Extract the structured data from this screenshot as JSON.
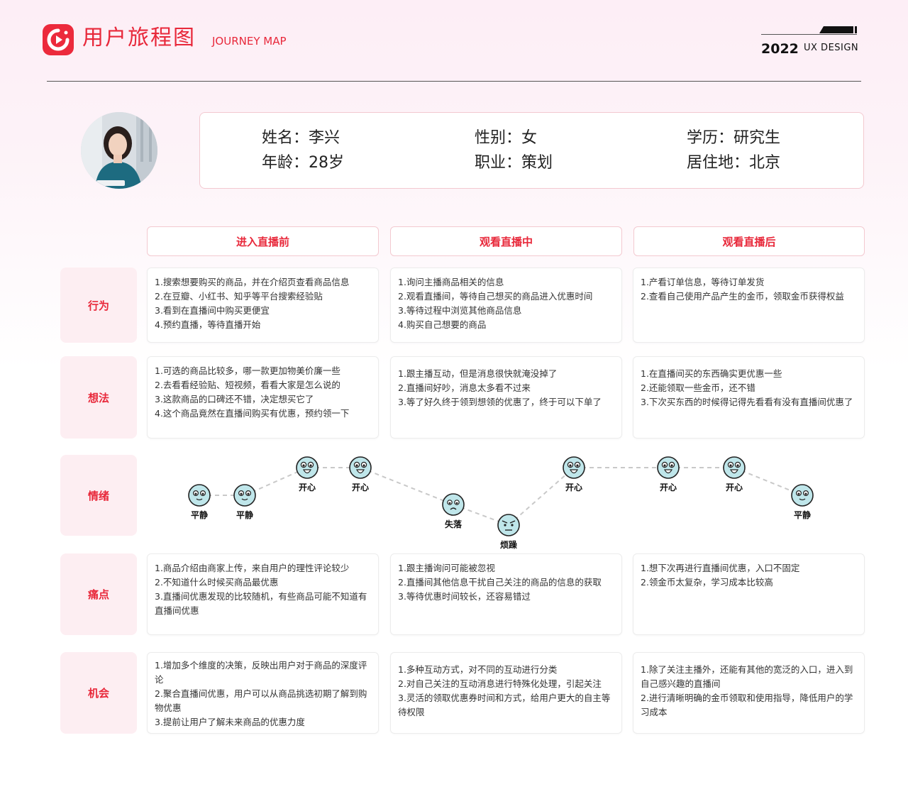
{
  "header": {
    "title": "用户旅程图",
    "subtitle": "JOURNEY MAP",
    "year": "2022",
    "ux": "UX DESIGN"
  },
  "profile": {
    "name": "姓名：李兴",
    "gender": "性别：女",
    "education": "学历：研究生",
    "age": "年龄：28岁",
    "job": "职业：策划",
    "residence": "居住地：北京"
  },
  "phases": [
    "进入直播前",
    "观看直播中",
    "观看直播后"
  ],
  "rows": {
    "behavior": {
      "label": "行为",
      "cards": [
        [
          "1.搜索想要购买的商品，并在介绍页查看商品信息",
          "2.在豆瓣、小红书、知乎等平台搜索经验贴",
          "3.看到在直播间中购买更便宜",
          "4.预约直播，等待直播开始"
        ],
        [
          "1.询问主播商品相关的信息",
          "2.观看直播间，等待自己想买的商品进入优惠时间",
          "3.等待过程中浏览其他商品信息",
          "4.购买自己想要的商品"
        ],
        [
          "1.产看订单信息，等待订单发货",
          "2.查看自己使用产品产生的金币，领取金币获得权益"
        ]
      ]
    },
    "thoughts": {
      "label": "想法",
      "cards": [
        [
          "1.可选的商品比较多，哪一款更加物美价廉一些",
          "2.去看看经验贴、短视频，看看大家是怎么说的",
          "3.这款商品的口碑还不错，决定想买它了",
          "4.这个商品竟然在直播间购买有优惠，预约领一下"
        ],
        [
          "1.跟主播互动，但是消息很快就淹没掉了",
          "2.直播间好吵，消息太多看不过来",
          "3.等了好久终于领到想领的优惠了，终于可以下单了"
        ],
        [
          "1.在直播间买的东西确实更优惠一些",
          "2.还能领取一些金币，还不错",
          "3.下次买东西的时候得记得先看看有没有直播间优惠了"
        ]
      ]
    },
    "emotion": {
      "label": "情绪",
      "points": [
        {
          "label": "平静",
          "level": 1,
          "mood": "calm"
        },
        {
          "label": "平静",
          "level": 1,
          "mood": "calm"
        },
        {
          "label": "开心",
          "level": 2,
          "mood": "happy"
        },
        {
          "label": "开心",
          "level": 2,
          "mood": "happy"
        },
        {
          "label": "失落",
          "level": 0,
          "mood": "sad"
        },
        {
          "label": "烦躁",
          "level": -1,
          "mood": "annoyed"
        },
        {
          "label": "开心",
          "level": 2,
          "mood": "happy"
        },
        {
          "label": "开心",
          "level": 2,
          "mood": "happy"
        },
        {
          "label": "开心",
          "level": 2,
          "mood": "happy"
        },
        {
          "label": "平静",
          "level": 1,
          "mood": "calm"
        }
      ]
    },
    "pain": {
      "label": "痛点",
      "cards": [
        [
          "1.商品介绍由商家上传，来自用户的理性评论较少",
          "2.不知道什么时候买商品最优惠",
          "3.直播间优惠发现的比较随机，有些商品可能不知道有直播间优惠"
        ],
        [
          "1.跟主播询问可能被忽视",
          "2.直播间其他信息干扰自己关注的商品的信息的获取",
          "3.等待优惠时间较长，还容易错过"
        ],
        [
          "1.想下次再进行直播间优惠，入口不固定",
          "2.领金币太复杂，学习成本比较高"
        ]
      ]
    },
    "opportunity": {
      "label": "机会",
      "cards": [
        [
          "1.增加多个维度的决策，反映出用户对于商品的深度评论",
          "2.聚合直播间优惠，用户可以从商品挑选初期了解到购物优惠",
          "3.提前让用户了解未来商品的优惠力度"
        ],
        [
          "1.多种互动方式，对不同的互动进行分类",
          "2.对自己关注的互动消息进行特殊化处理，引起关注",
          "3.灵活的领取优惠券时间和方式，给用户更大的自主等待权限"
        ],
        [
          "1.除了关注主播外，还能有其他的宽泛的入口，进入到自己感兴趣的直播间",
          "2.进行清晰明确的金币领取和使用指导，降低用户的学习成本"
        ]
      ]
    }
  },
  "colors": {
    "accent": "#e8283a",
    "label_bg": "#fdeef2",
    "face": "#bfe6ea"
  }
}
